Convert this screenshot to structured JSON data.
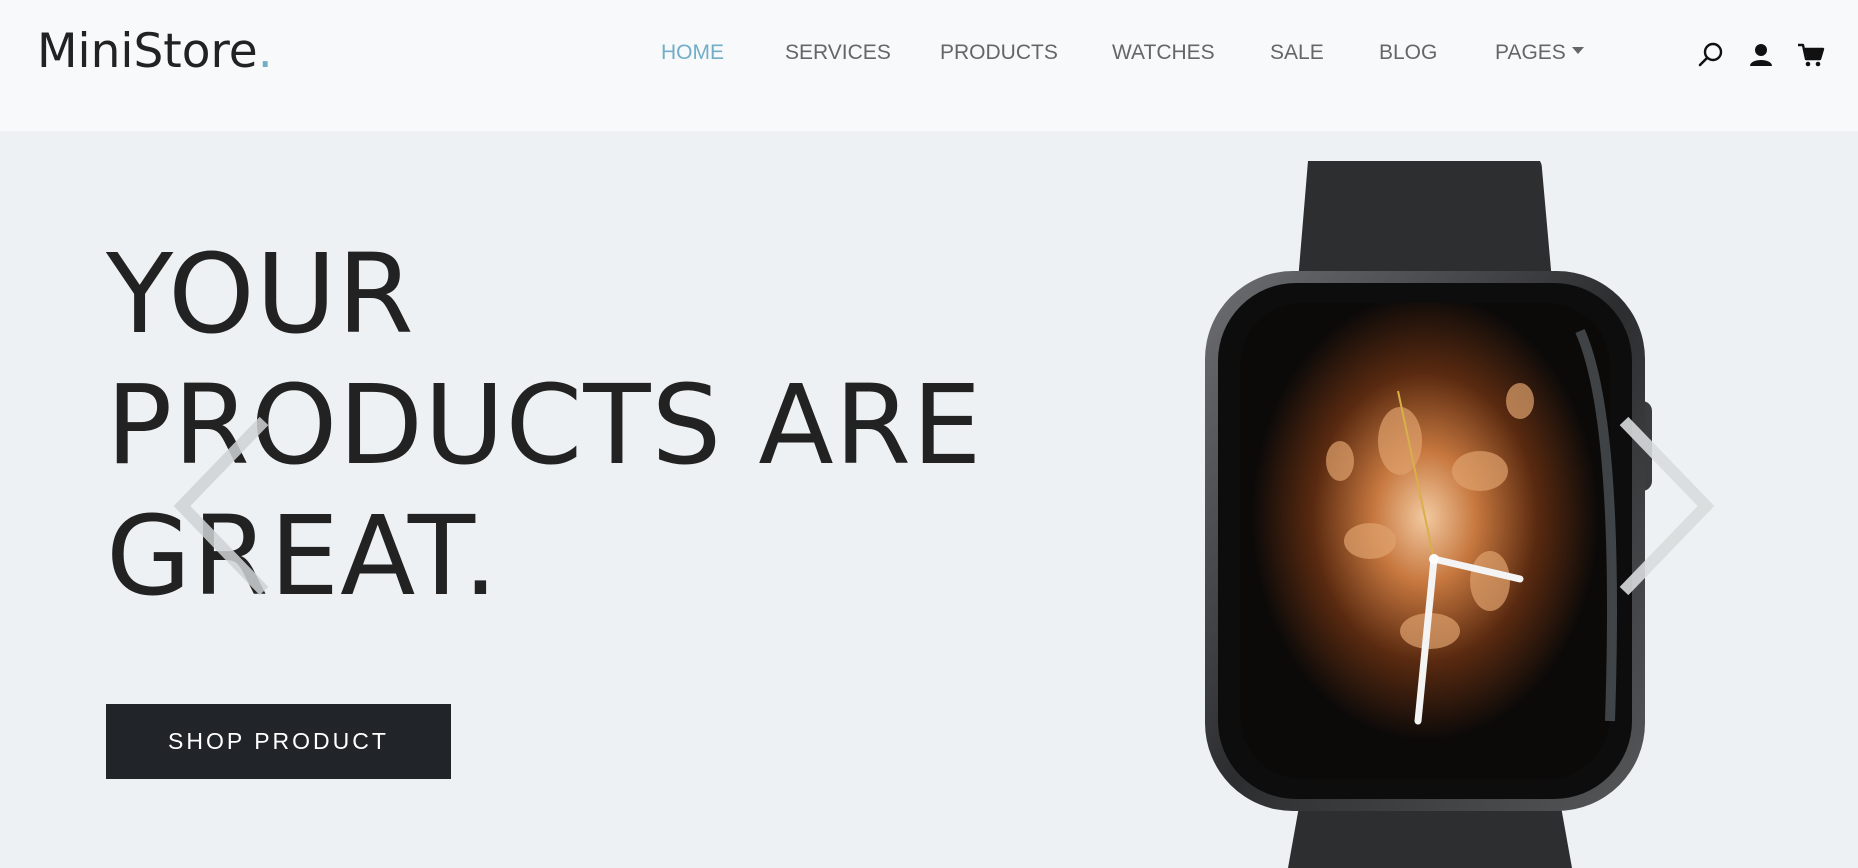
{
  "brand": {
    "name": "MiniStore",
    "dot": ".",
    "accent": "#72aec8"
  },
  "nav": {
    "items": [
      {
        "label": "HOME",
        "active": true
      },
      {
        "label": "SERVICES"
      },
      {
        "label": "PRODUCTS"
      },
      {
        "label": "WATCHES"
      },
      {
        "label": "SALE"
      },
      {
        "label": "BLOG"
      },
      {
        "label": "PAGES",
        "dropdown": true
      }
    ]
  },
  "header_icons": [
    "search-icon",
    "user-icon",
    "cart-icon"
  ],
  "hero": {
    "headline_lines": [
      "YOUR",
      "PRODUCTS ARE",
      "GREAT."
    ],
    "cta_label": "SHOP PRODUCT",
    "prev_icon": "chevron-left-icon",
    "next_icon": "chevron-right-icon",
    "image": "smartwatch-image"
  },
  "colors": {
    "dark": "#212529",
    "text": "#222222",
    "nav_text": "#666666",
    "hero_bg": "#edf1f3"
  }
}
